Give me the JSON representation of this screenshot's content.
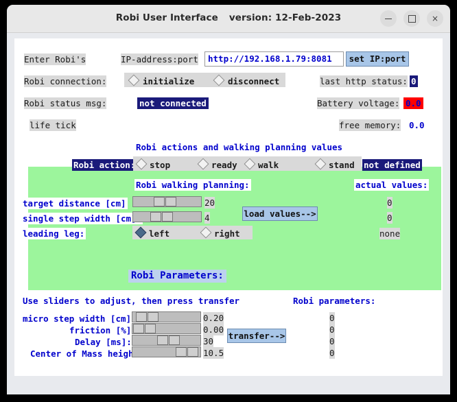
{
  "window": {
    "title": "Robi User Interface",
    "version": "version: 12-Feb-2023",
    "minimize_label": "",
    "maximize_label": "",
    "close_label": "×"
  },
  "connection": {
    "enter_label": "Enter Robi's",
    "ip_label": "IP-address:port",
    "ip_value": "http://192.168.1.79:8081",
    "set_button": "set IP:port",
    "conn_label": "Robi connection:",
    "initialize_label": "initialize",
    "disconnect_label": "disconnect",
    "http_status_label": "last http status:",
    "http_status_value": "0"
  },
  "status": {
    "msg_label": "Robi status msg:",
    "msg_value": "not connected",
    "battery_label": "Battery voltage:",
    "battery_value": "0.0",
    "life_tick_label": "life tick",
    "free_memory_label": "free memory:",
    "free_memory_value": "0.0"
  },
  "actions_panel": {
    "title": "Robi actions and walking planning values",
    "action_label": "Robi action:",
    "options": [
      "stop",
      "ready",
      "walk",
      "stand"
    ],
    "selected_option": null,
    "state_value": "not defined",
    "planning_title": "Robi walking planning:",
    "actual_values_title": "actual values:",
    "load_button": "load values-->",
    "rows": [
      {
        "label": "target distance [cm]",
        "value": "20",
        "actual": "0",
        "thumb_pct": 34
      },
      {
        "label": "single step width [cm]:",
        "value": "4",
        "actual": "0",
        "thumb_pct": 29
      }
    ],
    "leg_label": "leading leg:",
    "leg_options": [
      "left",
      "right"
    ],
    "leg_selected": "left",
    "leg_actual": "none"
  },
  "parameters_panel": {
    "title": "Robi Parameters:",
    "hint": "Use sliders to adjust, then press transfer",
    "column_title": "Robi parameters:",
    "transfer_button": "transfer-->",
    "rows": [
      {
        "label": "micro step width [cm]:",
        "value": "0.20",
        "robi": "0",
        "thumb_pct": 6
      },
      {
        "label": "friction [%]:",
        "value": "0.00",
        "robi": "0",
        "thumb_pct": 1
      },
      {
        "label": "Delay [ms]:",
        "value": "30",
        "robi": "0",
        "thumb_pct": 40
      },
      {
        "label": "Center of Mass height:",
        "value": "10.5",
        "robi": "0",
        "thumb_pct": 68
      }
    ]
  },
  "colors": {
    "panel_green": "#9cf59c",
    "accent_blue": "#0000cc",
    "navy_badge": "#1a1a7a",
    "alert_red": "#ff0000",
    "button_blue": "#a8c6e8"
  }
}
